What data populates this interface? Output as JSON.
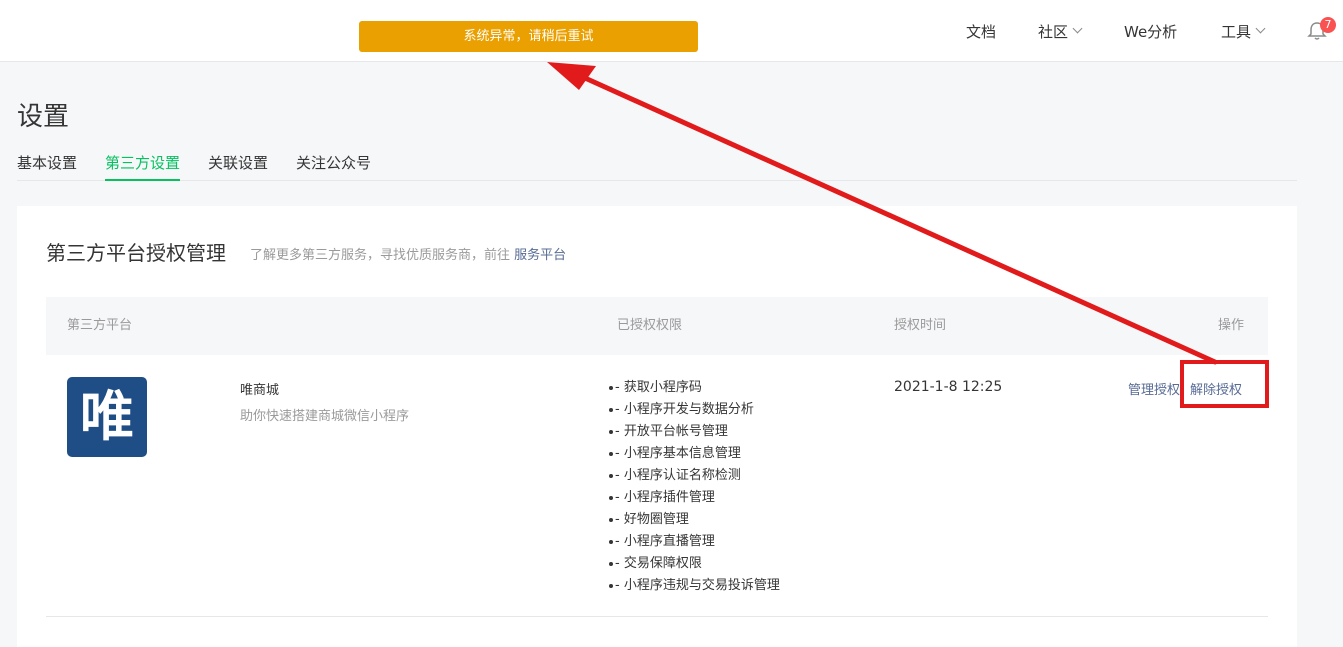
{
  "toast": {
    "message": "系统异常，请稍后重试"
  },
  "topnav": {
    "docs": "文档",
    "community": "社区",
    "we_analytics": "We分析",
    "tools": "工具",
    "notification_count": "7"
  },
  "page": {
    "title": "设置",
    "tabs": [
      "基本设置",
      "第三方设置",
      "关联设置",
      "关注公众号"
    ],
    "active_tab": "第三方设置"
  },
  "card": {
    "title": "第三方平台授权管理",
    "desc_prefix": "了解更多第三方服务，寻找优质服务商，前往",
    "desc_link": "服务平台"
  },
  "table": {
    "headers": {
      "platform": "第三方平台",
      "permissions": "已授权权限",
      "auth_time": "授权时间",
      "actions": "操作"
    },
    "row": {
      "logo_text": "唯",
      "name": "唯商城",
      "description": "助你快速搭建商城微信小程序",
      "permissions": [
        "- 获取小程序码",
        "- 小程序开发与数据分析",
        "- 开放平台帐号管理",
        "- 小程序基本信息管理",
        "- 小程序认证名称检测",
        "- 小程序插件管理",
        "- 好物圈管理",
        "- 小程序直播管理",
        "- 交易保障权限",
        "- 小程序违规与交易投诉管理"
      ],
      "auth_time": "2021-1-8 12:25",
      "action_manage": "管理授权",
      "action_revoke": "解除授权"
    }
  },
  "colors": {
    "toast_bg": "#eaa000",
    "active_tab": "#07c160",
    "link": "#576b95",
    "annotation": "#e11b1b",
    "logo_bg": "#1f4e86"
  }
}
